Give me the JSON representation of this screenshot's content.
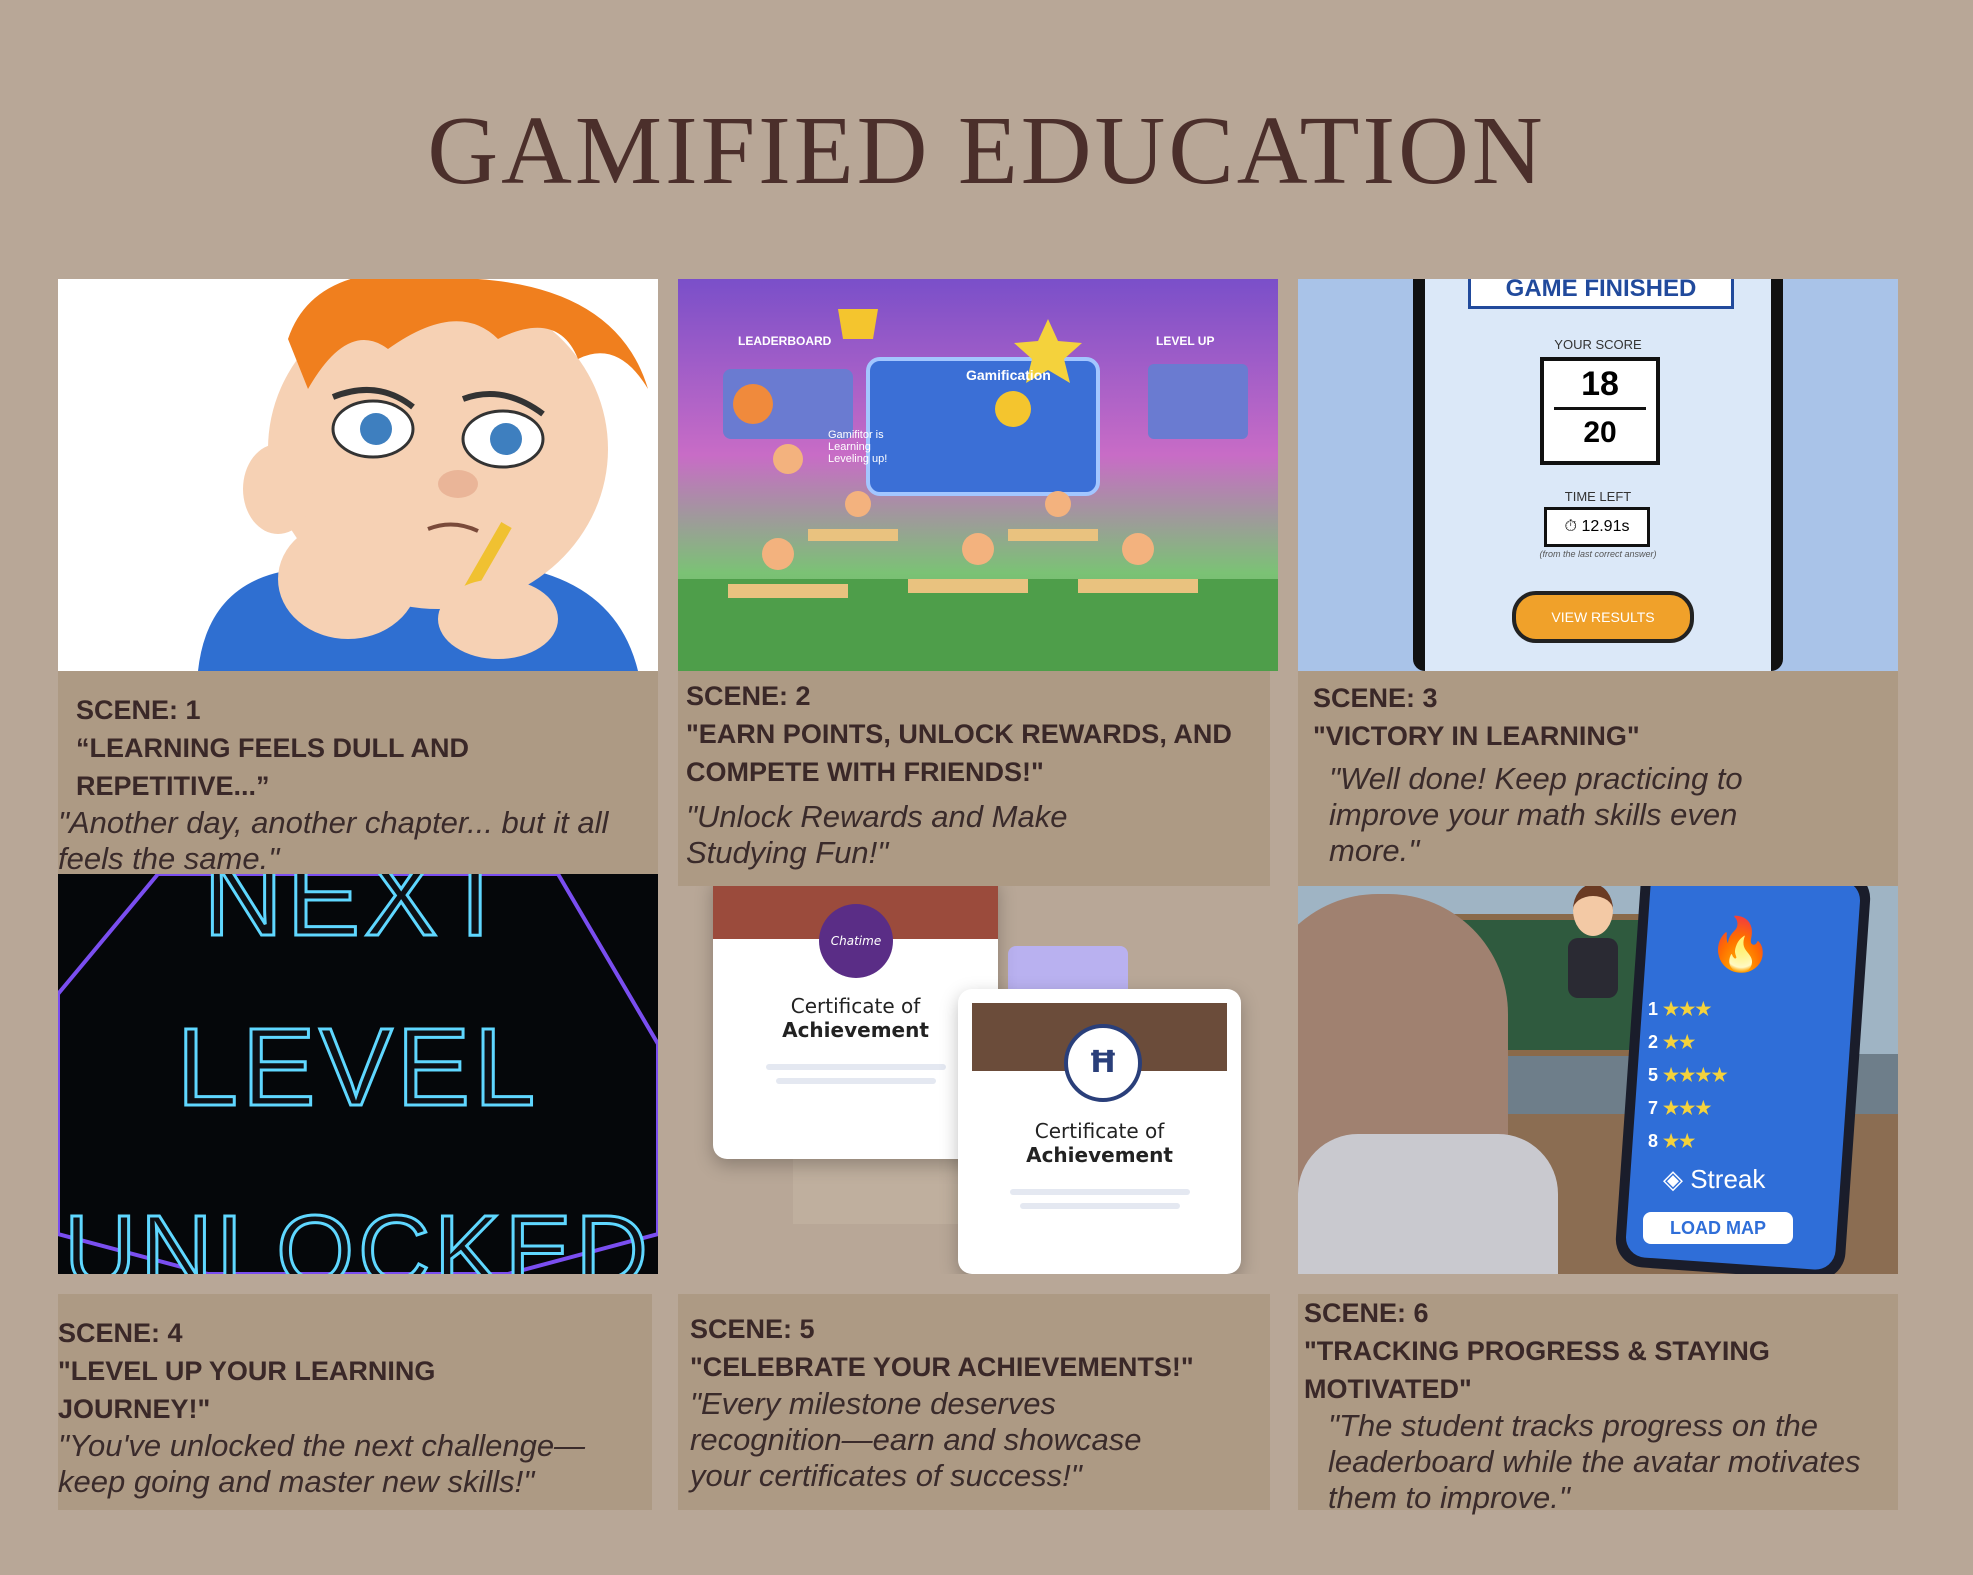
{
  "title": "GAMIFIED EDUCATION",
  "scenes": [
    {
      "scene": "SCENE: 1",
      "heading_line1": "“LEARNING FEELS DULL AND",
      "heading_line2": "REPETITIVE...”",
      "quote": "\"Another day, another chapter... but it all feels the same.\""
    },
    {
      "scene": "SCENE: 2",
      "heading_line1": "\"EARN POINTS, UNLOCK REWARDS, AND",
      "heading_line2": "COMPETE WITH FRIENDS!\"",
      "quote": "\"Unlock Rewards and Make Studying Fun!\""
    },
    {
      "scene": "SCENE: 3",
      "heading_line1": "\"VICTORY IN LEARNING\"",
      "heading_line2": "",
      "quote": "\"Well done! Keep practicing to improve your math skills even more.\""
    },
    {
      "scene": "SCENE: 4",
      "heading_line1": "\"LEVEL UP YOUR LEARNING",
      "heading_line2": "JOURNEY!\"",
      "quote": "\"You've unlocked the next challenge—keep going and master new skills!\""
    },
    {
      "scene": "SCENE: 5",
      "heading_line1": "\"CELEBRATE YOUR ACHIEVEMENTS!\"",
      "heading_line2": "",
      "quote": "\"Every milestone deserves recognition—earn and showcase your certificates of success!\""
    },
    {
      "scene": "SCENE: 6",
      "heading_line1": "\"TRACKING PROGRESS & STAYING",
      "heading_line2": "MOTIVATED\"",
      "quote": "\"The student tracks progress on the leaderboard while the avatar motivates them to improve.\""
    }
  ],
  "img2_labels": {
    "leaderboard": "LEADERBOARD",
    "levelup": "LEVEL UP",
    "gamification": "Gamification",
    "gamifier": "Gamifitor is Learning Leveling up!"
  },
  "img3": {
    "header": "GAME FINISHED",
    "score_label": "YOUR SCORE",
    "score": "18",
    "total": "20",
    "time_label": "TIME LEFT",
    "time": "12.91s",
    "time_note": "(from the last correct answer)",
    "button": "VIEW RESULTS"
  },
  "img4": {
    "line1": "NEXT",
    "line2": "LEVEL",
    "line3": "UNLOCKED"
  },
  "img5": {
    "cert_t1": "Certificate of",
    "cert_t2": "Achievement",
    "brand": "Chatime"
  },
  "img6": {
    "rows": [
      "1",
      "2",
      "5",
      "7",
      "8"
    ],
    "streak": "Streak",
    "button": "LOAD MAP"
  }
}
